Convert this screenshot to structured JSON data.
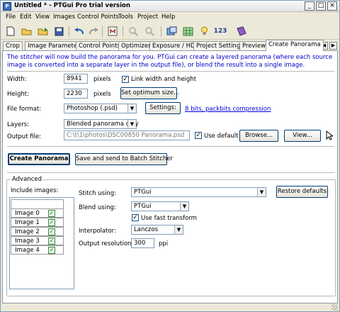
{
  "title": "Untitled * - PTGui Pro trial version",
  "menu": [
    "File",
    "Edit",
    "View",
    "Images",
    "Control Points",
    "Tools",
    "Project",
    "Help"
  ],
  "toolbar": {
    "counter_label": "123"
  },
  "tabs": [
    "Crop",
    "Image Parameters",
    "Control Points",
    "Optimizer",
    "Exposure / HDR",
    "Project Settings",
    "Preview",
    "Create Panorama"
  ],
  "info": "The stitcher will now build the panorama for you. PTGui can create a layered panorama (where each source image is converted into a separate layer in the output file), or blend the result into a single image.",
  "width": {
    "label": "Width:",
    "value": "8941",
    "unit": "pixels"
  },
  "height": {
    "label": "Height:",
    "value": "2230",
    "unit": "pixels"
  },
  "link_label": "Link width and height",
  "optimum_button": "Set optimum size...",
  "file_format": {
    "label": "File format:",
    "value": "Photoshop (.psd)",
    "settings_button": "Settings:",
    "settings_link": "8 bits, packbits compression"
  },
  "layers": {
    "label": "Layers:",
    "value": "Blended panorama only"
  },
  "output": {
    "label": "Output file:",
    "value": "C:\\t\\1\\photos\\DSC00850 Panorama.psd",
    "default_label": "Use default",
    "browse_button": "Browse...",
    "view_button": "View..."
  },
  "create_button": "Create Panorama",
  "batch_button": "Save and send to Batch Stitcher",
  "advanced": {
    "legend": "Advanced",
    "include_label": "Include images:",
    "stitch_label": "Stitch using:",
    "stitch_value": "PTGui",
    "restore_button": "Restore defaults",
    "blend_label": "Blend using:",
    "blend_value": "PTGui",
    "fast_label": "Use fast transform",
    "interp_label": "Interpolator:",
    "interp_value": "Lanczos",
    "res_label": "Output resolution:",
    "res_value": "300",
    "res_unit": "ppi",
    "images": [
      "Image 0",
      "Image 1",
      "Image 2",
      "Image 3",
      "Image 4"
    ]
  }
}
